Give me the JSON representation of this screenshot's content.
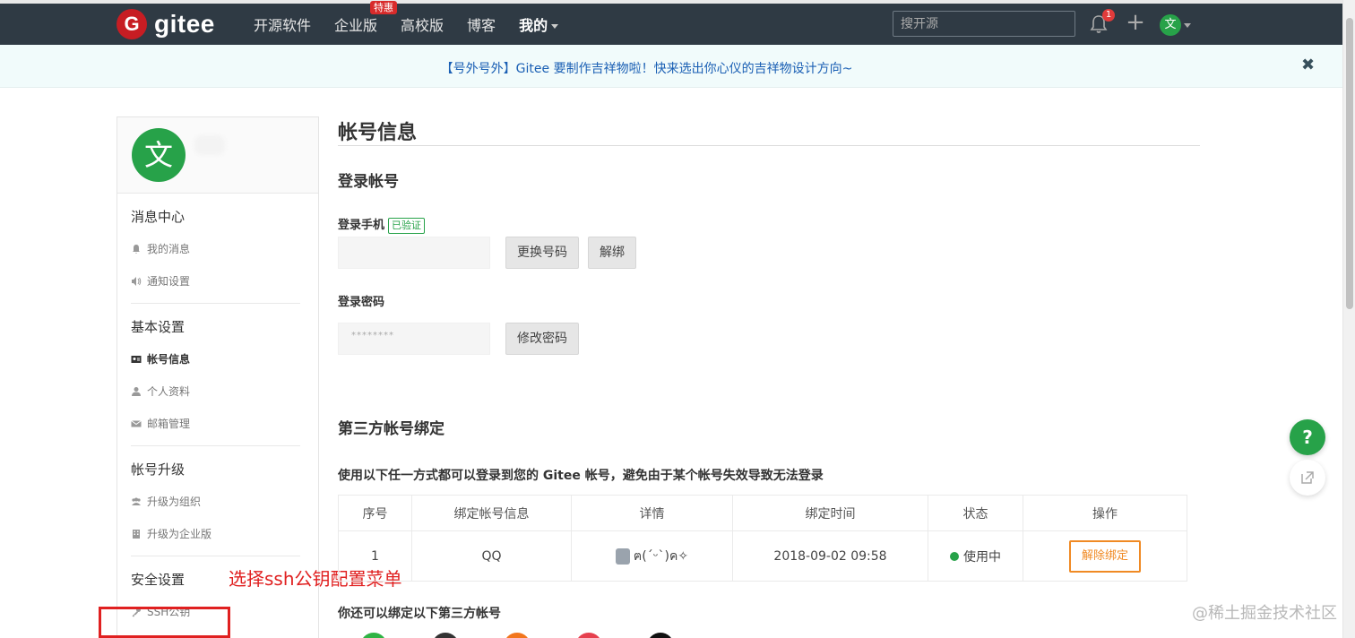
{
  "header": {
    "logo_text": "gitee",
    "logo_mark": "G",
    "nav": [
      {
        "label": "开源软件"
      },
      {
        "label": "企业版",
        "badge": "特惠"
      },
      {
        "label": "高校版"
      },
      {
        "label": "博客"
      },
      {
        "label": "我的"
      }
    ],
    "search_placeholder": "搜开源",
    "notification_count": "1",
    "avatar_char": "文"
  },
  "banner": {
    "text": "【号外号外】Gitee 要制作吉祥物啦！快来选出你心仪的吉祥物设计方向~",
    "close": "✖"
  },
  "sidebar": {
    "avatar_char": "文",
    "groups": [
      {
        "title": "消息中心",
        "items": [
          "我的消息",
          "通知设置"
        ]
      },
      {
        "title": "基本设置",
        "items": [
          "帐号信息",
          "个人资料",
          "邮箱管理"
        ]
      },
      {
        "title": "帐号升级",
        "items": [
          "升级为组织",
          "升级为企业版"
        ]
      },
      {
        "title": "安全设置",
        "items": [
          "SSH公钥"
        ]
      }
    ]
  },
  "annotation": "选择ssh公钥配置菜单",
  "main": {
    "page_title": "帐号信息",
    "login_account_title": "登录帐号",
    "phone_label": "登录手机",
    "verified": "已验证",
    "change_number": "更换号码",
    "unbind": "解绑",
    "password_label": "登录密码",
    "password_mask": "********",
    "change_password": "修改密码",
    "third_party_title": "第三方帐号绑定",
    "third_party_desc": "使用以下任一方式都可以登录到您的 Gitee 帐号，避免由于某个帐号失效导致无法登录",
    "table": {
      "headers": [
        "序号",
        "绑定帐号信息",
        "详情",
        "绑定时间",
        "状态",
        "操作"
      ],
      "rows": [
        {
          "index": "1",
          "account": "QQ",
          "detail": "ฅ(ˊᵕˋ)ค✧",
          "time": "2018-09-02 09:58",
          "status": "使用中",
          "action": "解除绑定"
        }
      ]
    },
    "more_bind_title": "你还可以绑定以下第三方帐号"
  },
  "floating": {
    "help": "?"
  },
  "watermark": "@稀土掘金技术社区",
  "colors": {
    "header_bg": "#2f3a44",
    "brand_red": "#c71d23",
    "green": "#27a249",
    "orange": "#f08a24",
    "annotation_red": "#e02020"
  }
}
